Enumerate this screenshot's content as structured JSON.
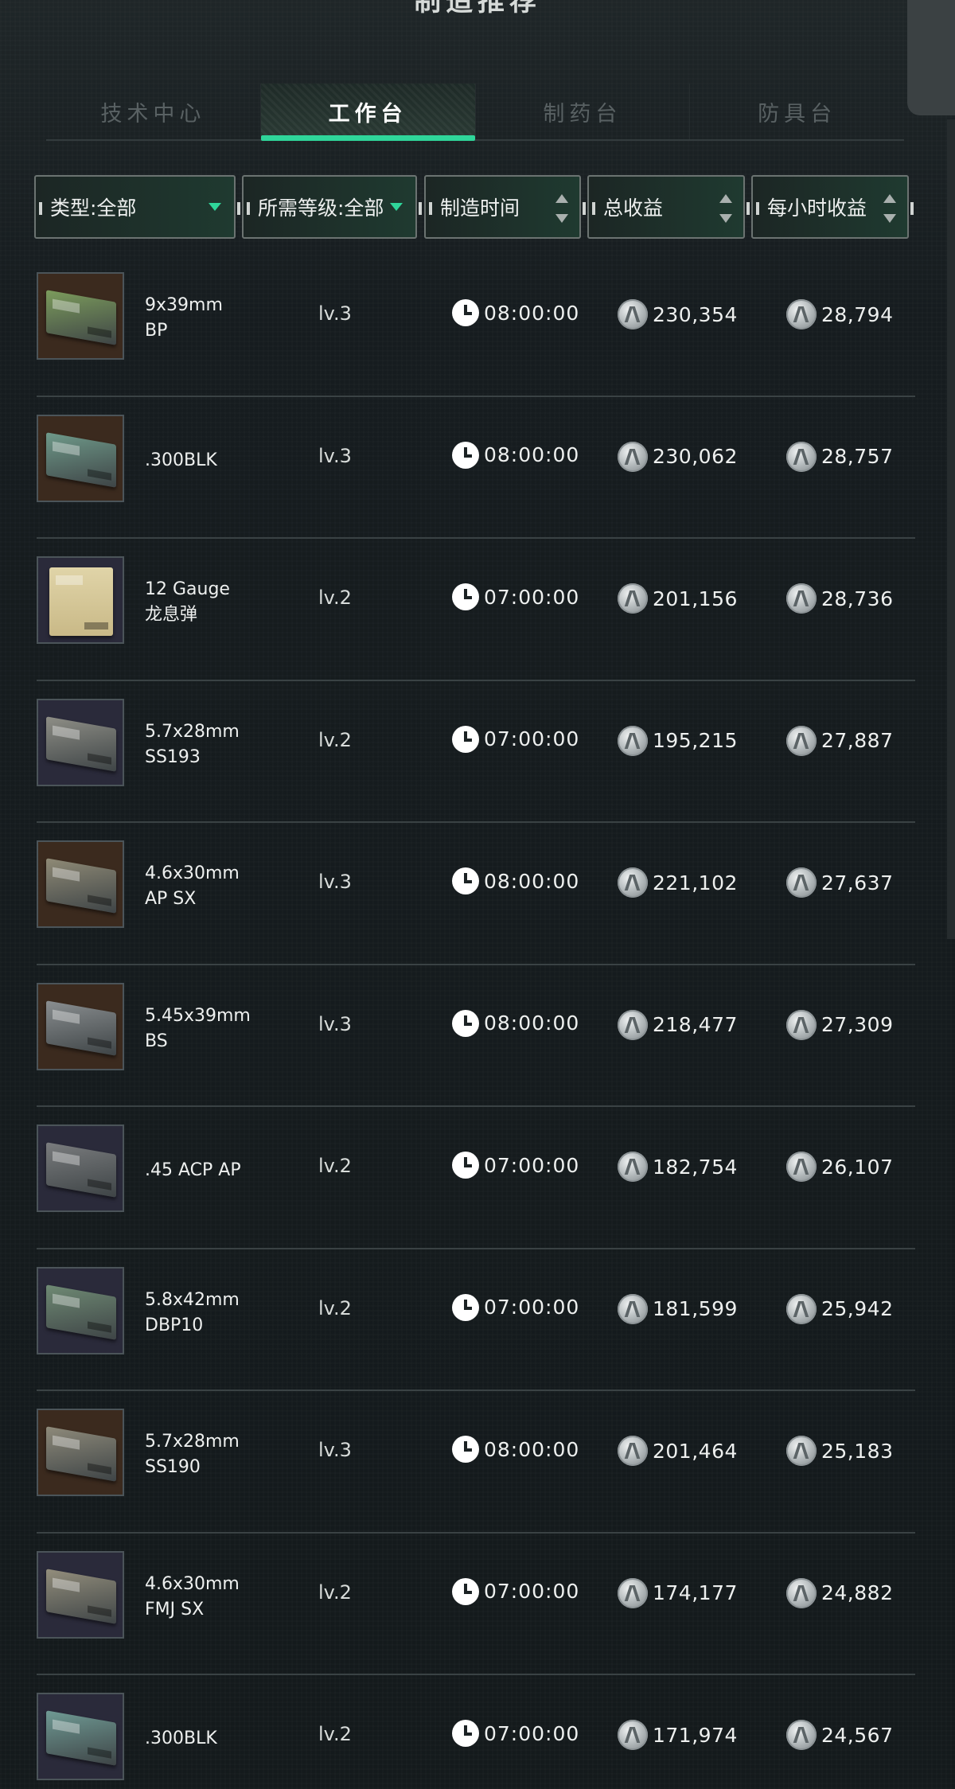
{
  "header": {
    "title": "制造推荐"
  },
  "tabs": [
    {
      "label": "技术中心",
      "active": false
    },
    {
      "label": "工作台",
      "active": true
    },
    {
      "label": "制药台",
      "active": false
    },
    {
      "label": "防具台",
      "active": false
    }
  ],
  "filters": {
    "type": "类型:全部",
    "level": "所需等级:全部",
    "time": "制造时间",
    "total": "总收益",
    "hourly": "每小时收益"
  },
  "colors": {
    "accent": "#2fd69a",
    "background": "#161c1f"
  },
  "items": [
    {
      "name": "9x39mm BP",
      "level": "lv.3",
      "time": "08:00:00",
      "total": "230,354",
      "hourly": "28,794",
      "icon": "ammo-box-green",
      "box_color": "#7c9c5c",
      "bg": "#3b2a1e"
    },
    {
      "name": ".300BLK",
      "level": "lv.3",
      "time": "08:00:00",
      "total": "230,062",
      "hourly": "28,757",
      "icon": "ammo-box-teal",
      "box_color": "#6f9a8a",
      "bg": "#3b2a1e"
    },
    {
      "name": "12 Gauge 龙息弹",
      "level": "lv.2",
      "time": "07:00:00",
      "total": "201,156",
      "hourly": "28,736",
      "icon": "ammo-crate",
      "box_color": "#d6c896",
      "bg": "#2a2a3a"
    },
    {
      "name": "5.7x28mm SS193",
      "level": "lv.2",
      "time": "07:00:00",
      "total": "195,215",
      "hourly": "27,887",
      "icon": "ammo-box-gray",
      "box_color": "#8e8e86",
      "bg": "#2a2a3a"
    },
    {
      "name": "4.6x30mm AP SX",
      "level": "lv.3",
      "time": "08:00:00",
      "total": "221,102",
      "hourly": "27,637",
      "icon": "ammo-box-tan",
      "box_color": "#8f8a76",
      "bg": "#3b2a1e"
    },
    {
      "name": "5.45x39mm BS",
      "level": "lv.3",
      "time": "08:00:00",
      "total": "218,477",
      "hourly": "27,309",
      "icon": "ammo-box-gray",
      "box_color": "#8a8e90",
      "bg": "#3b2a1e"
    },
    {
      "name": ".45 ACP AP",
      "level": "lv.2",
      "time": "07:00:00",
      "total": "182,754",
      "hourly": "26,107",
      "icon": "ammo-box-gray",
      "box_color": "#7a7c7e",
      "bg": "#2a2a3a"
    },
    {
      "name": "5.8x42mm DBP10",
      "level": "lv.2",
      "time": "07:00:00",
      "total": "181,599",
      "hourly": "25,942",
      "icon": "ammo-box-green",
      "box_color": "#6f8a74",
      "bg": "#2a2a3a"
    },
    {
      "name": "5.7x28mm SS190",
      "level": "lv.3",
      "time": "08:00:00",
      "total": "201,464",
      "hourly": "25,183",
      "icon": "ammo-box-tan",
      "box_color": "#8e8a7a",
      "bg": "#3b2a1e"
    },
    {
      "name": "4.6x30mm FMJ SX",
      "level": "lv.2",
      "time": "07:00:00",
      "total": "174,177",
      "hourly": "24,882",
      "icon": "ammo-box-tan",
      "box_color": "#938e7c",
      "bg": "#2a2a3a"
    },
    {
      "name": ".300BLK",
      "level": "lv.2",
      "time": "07:00:00",
      "total": "171,974",
      "hourly": "24,567",
      "icon": "ammo-box-teal",
      "box_color": "#6f9a94",
      "bg": "#2a2a3a"
    }
  ]
}
